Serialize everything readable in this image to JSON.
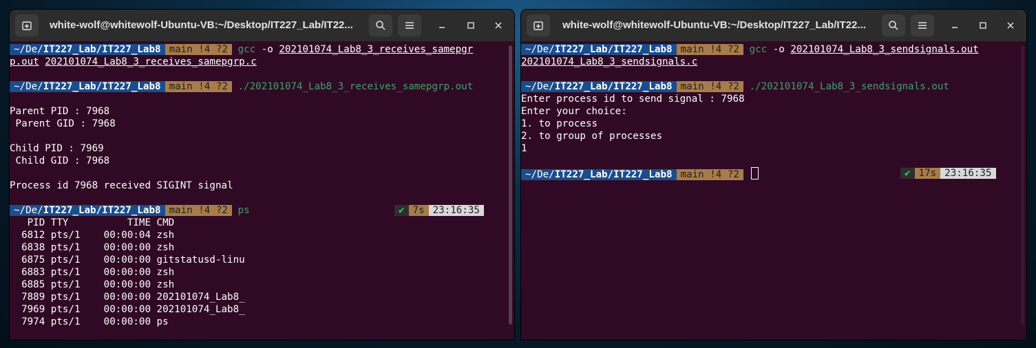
{
  "colors": {
    "terminal_bg": "#300a24",
    "dir_bg": "#1a4d8c",
    "git_bg": "#a87c4a",
    "cmd": "#3fa06a",
    "check": "#2bd66b"
  },
  "icons": {
    "new_tab": "new-tab-icon",
    "search": "search-icon",
    "menu": "hamburger-menu-icon",
    "minimize": "minimize-icon",
    "maximize": "maximize-icon",
    "close": "close-icon"
  },
  "left": {
    "title": "white-wolf@whitewolf-Ubuntu-VB:~/Desktop/IT227_Lab/IT22...",
    "prompt": {
      "dir_prefix": "~/De/",
      "dir_bold": "IT227_Lab/IT227_Lab8",
      "git": "main !4 ?2"
    },
    "cmd1": {
      "gcc": "gcc",
      "flag": " -o ",
      "arg1": "202101074_Lab8_3_receives_samepgr",
      "arg1b": "p.out",
      "arg2": "202101074_Lab8_3_receives_samepgrp.c"
    },
    "cmd2": "./202101074_Lab8_3_receives_samepgrp.out",
    "out": [
      "Parent PID : 7968",
      " Parent GID : 7968",
      "Child PID : 7969",
      " Child GID : 7968",
      "Process id 7968 received SIGINT signal"
    ],
    "cmd3": "ps",
    "right_prompt": {
      "check": "✔",
      "duration": "7s",
      "time": "23:16:35"
    },
    "ps_header": "   PID TTY          TIME CMD",
    "ps_rows": [
      "  6812 pts/1    00:00:04 zsh",
      "  6838 pts/1    00:00:00 zsh",
      "  6875 pts/1    00:00:00 gitstatusd-linu",
      "  6883 pts/1    00:00:00 zsh",
      "  6885 pts/1    00:00:00 zsh",
      "  7889 pts/1    00:00:00 202101074_Lab8_",
      "  7969 pts/1    00:00:00 202101074_Lab8_",
      "  7974 pts/1    00:00:00 ps"
    ]
  },
  "right": {
    "title": "white-wolf@whitewolf-Ubuntu-VB:~/Desktop/IT227_Lab/IT22...",
    "prompt": {
      "dir_prefix": "~/De/",
      "dir_bold": "IT227_Lab/IT227_Lab8",
      "git": "main !4 ?2"
    },
    "cmd1": {
      "gcc": "gcc",
      "flag": " -o ",
      "arg1": "202101074_Lab8_3_sendsignals.out",
      "arg2": "202101074_Lab8_3_sendsignals.c"
    },
    "cmd2": "./202101074_Lab8_3_sendsignals.out",
    "out": [
      "Enter process id to send signal : 7968",
      "Enter your choice:",
      "1. to process",
      "2. to group of processes",
      "1"
    ],
    "right_prompt": {
      "check": "✔",
      "duration": "17s",
      "time": "23:16:35"
    }
  }
}
